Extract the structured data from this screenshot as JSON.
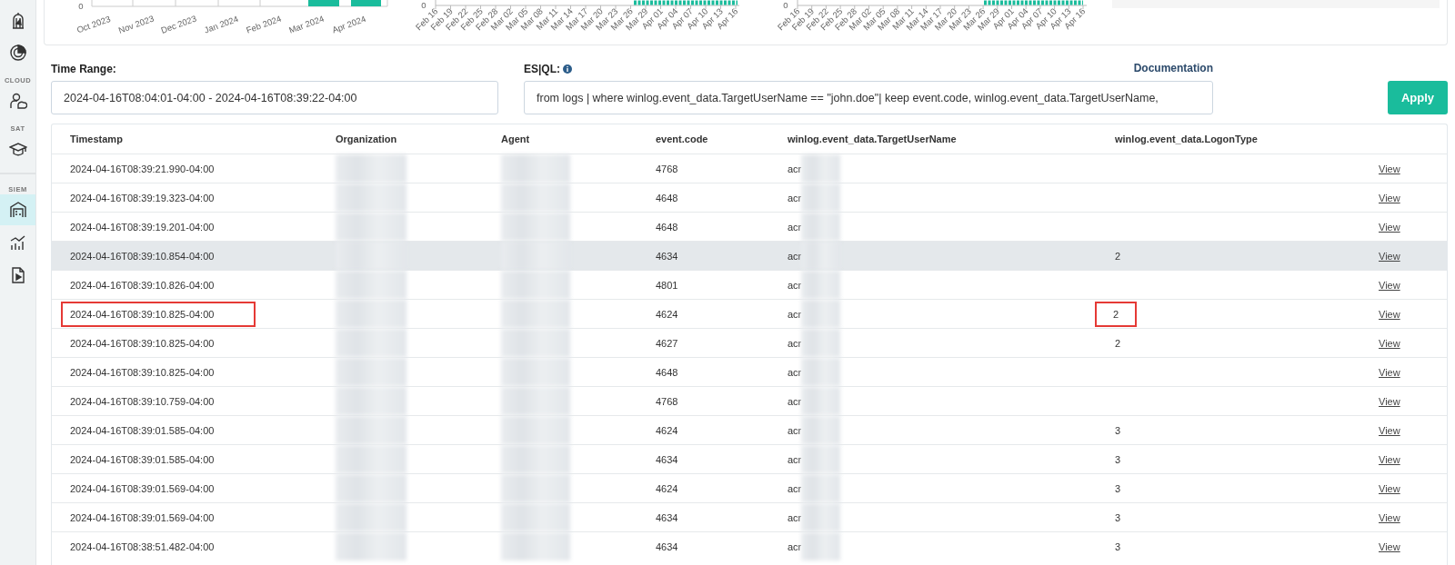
{
  "sidebar": {
    "items": [
      {
        "kind": "icon",
        "selected": false
      },
      {
        "kind": "icon",
        "selected": false
      },
      {
        "kind": "section",
        "label": "CLOUD"
      },
      {
        "kind": "icon",
        "selected": false
      },
      {
        "kind": "section",
        "label": "SAT"
      },
      {
        "kind": "icon",
        "selected": false
      },
      {
        "kind": "divider"
      },
      {
        "kind": "section",
        "label": "SIEM"
      },
      {
        "kind": "icon",
        "selected": true
      },
      {
        "kind": "icon",
        "selected": false
      },
      {
        "kind": "icon",
        "selected": false
      }
    ]
  },
  "top_charts": [
    {
      "kind": "months",
      "y_tick": "0",
      "x_labels": [
        "Oct 2023",
        "Nov 2023",
        "Dec 2023",
        "Jan 2024",
        "Feb 2024",
        "Mar 2024",
        "Apr 2024"
      ]
    },
    {
      "kind": "days",
      "y_tick": "0",
      "x_labels": [
        "Feb 16",
        "Feb 19",
        "Feb 22",
        "Feb 25",
        "Feb 28",
        "Mar 02",
        "Mar 05",
        "Mar 08",
        "Mar 11",
        "Mar 14",
        "Mar 17",
        "Mar 20",
        "Mar 23",
        "Mar 26",
        "Mar 29",
        "Apr 01",
        "Apr 04",
        "Apr 07",
        "Apr 10",
        "Apr 13",
        "Apr 16"
      ]
    },
    {
      "kind": "days",
      "y_tick": "0",
      "x_labels": [
        "Feb 16",
        "Feb 19",
        "Feb 22",
        "Feb 25",
        "Feb 28",
        "Mar 02",
        "Mar 05",
        "Mar 08",
        "Mar 11",
        "Mar 14",
        "Mar 17",
        "Mar 20",
        "Mar 23",
        "Mar 26",
        "Mar 29",
        "Apr 01",
        "Apr 04",
        "Apr 07",
        "Apr 10",
        "Apr 13",
        "Apr 16"
      ]
    }
  ],
  "query": {
    "time_range": {
      "label": "Time Range:",
      "value": "2024-04-16T08:04:01-04:00 - 2024-04-16T08:39:22-04:00"
    },
    "esql": {
      "label": "ES|QL:",
      "value": "from logs | where winlog.event_data.TargetUserName == \"john.doe\"| keep event.code, winlog.event_data.TargetUserName,"
    },
    "documentation_link": "Documentation",
    "apply_button": "Apply"
  },
  "table": {
    "columns": [
      "Timestamp",
      "Organization",
      "Agent",
      "event.code",
      "winlog.event_data.TargetUserName",
      "winlog.event_data.LogonType"
    ],
    "rows": [
      {
        "timestamp": "2024-04-16T08:39:21.990-04:00",
        "event_code": "4768",
        "target_user": "acr",
        "logon_type": "",
        "view": "View",
        "hovered": false,
        "timestamp_marked": false,
        "logon_type_marked": false
      },
      {
        "timestamp": "2024-04-16T08:39:19.323-04:00",
        "event_code": "4648",
        "target_user": "acr",
        "logon_type": "",
        "view": "View",
        "hovered": false,
        "timestamp_marked": false,
        "logon_type_marked": false
      },
      {
        "timestamp": "2024-04-16T08:39:19.201-04:00",
        "event_code": "4648",
        "target_user": "acr",
        "logon_type": "",
        "view": "View",
        "hovered": false,
        "timestamp_marked": false,
        "logon_type_marked": false
      },
      {
        "timestamp": "2024-04-16T08:39:10.854-04:00",
        "event_code": "4634",
        "target_user": "acr",
        "logon_type": "2",
        "view": "View",
        "hovered": true,
        "timestamp_marked": false,
        "logon_type_marked": false
      },
      {
        "timestamp": "2024-04-16T08:39:10.826-04:00",
        "event_code": "4801",
        "target_user": "acr",
        "logon_type": "",
        "view": "View",
        "hovered": false,
        "timestamp_marked": false,
        "logon_type_marked": false
      },
      {
        "timestamp": "2024-04-16T08:39:10.825-04:00",
        "event_code": "4624",
        "target_user": "acr",
        "logon_type": "2",
        "view": "View",
        "hovered": false,
        "timestamp_marked": true,
        "logon_type_marked": true
      },
      {
        "timestamp": "2024-04-16T08:39:10.825-04:00",
        "event_code": "4627",
        "target_user": "acr",
        "logon_type": "2",
        "view": "View",
        "hovered": false,
        "timestamp_marked": false,
        "logon_type_marked": false
      },
      {
        "timestamp": "2024-04-16T08:39:10.825-04:00",
        "event_code": "4648",
        "target_user": "acr",
        "logon_type": "",
        "view": "View",
        "hovered": false,
        "timestamp_marked": false,
        "logon_type_marked": false
      },
      {
        "timestamp": "2024-04-16T08:39:10.759-04:00",
        "event_code": "4768",
        "target_user": "acr",
        "logon_type": "",
        "view": "View",
        "hovered": false,
        "timestamp_marked": false,
        "logon_type_marked": false
      },
      {
        "timestamp": "2024-04-16T08:39:01.585-04:00",
        "event_code": "4624",
        "target_user": "acr",
        "logon_type": "3",
        "view": "View",
        "hovered": false,
        "timestamp_marked": false,
        "logon_type_marked": false
      },
      {
        "timestamp": "2024-04-16T08:39:01.585-04:00",
        "event_code": "4634",
        "target_user": "acr",
        "logon_type": "3",
        "view": "View",
        "hovered": false,
        "timestamp_marked": false,
        "logon_type_marked": false
      },
      {
        "timestamp": "2024-04-16T08:39:01.569-04:00",
        "event_code": "4624",
        "target_user": "acr",
        "logon_type": "3",
        "view": "View",
        "hovered": false,
        "timestamp_marked": false,
        "logon_type_marked": false
      },
      {
        "timestamp": "2024-04-16T08:39:01.569-04:00",
        "event_code": "4634",
        "target_user": "acr",
        "logon_type": "3",
        "view": "View",
        "hovered": false,
        "timestamp_marked": false,
        "logon_type_marked": false
      },
      {
        "timestamp": "2024-04-16T08:38:51.482-04:00",
        "event_code": "4634",
        "target_user": "acr",
        "logon_type": "3",
        "view": "View",
        "hovered": false,
        "timestamp_marked": false,
        "logon_type_marked": false
      }
    ]
  }
}
